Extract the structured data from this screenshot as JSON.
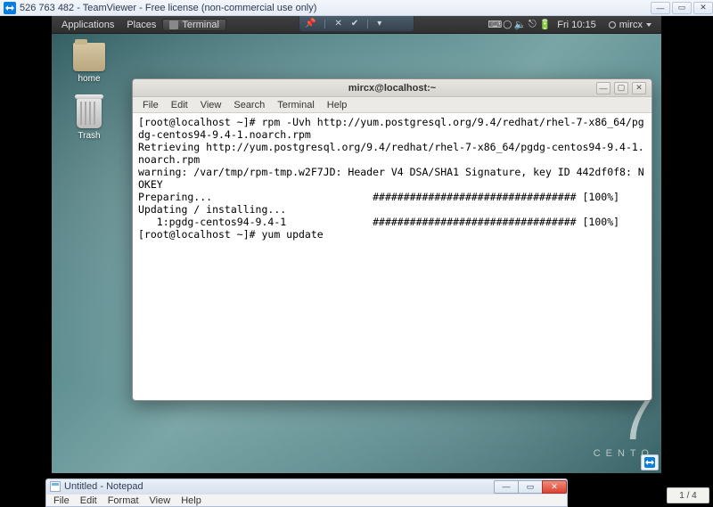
{
  "teamviewer_title": "526 763 482 - TeamViewer - Free license (non-commercial use only)",
  "gnome": {
    "applications": "Applications",
    "places": "Places",
    "task_terminal": "Terminal",
    "clock": "Fri 10:15",
    "user": "mircx"
  },
  "desktop": {
    "home": "home",
    "trash": "Trash",
    "centos_seven": "7",
    "centos_text": "CENTO"
  },
  "terminal": {
    "title": "mircx@localhost:~",
    "menu": {
      "file": "File",
      "edit": "Edit",
      "view": "View",
      "search": "Search",
      "terminal": "Terminal",
      "help": "Help"
    },
    "lines": {
      "l0": "[root@localhost ~]# rpm -Uvh http://yum.postgresql.org/9.4/redhat/rhel-7-x86_64/pgdg-centos94-9.4-1.noarch.rpm",
      "l1": "Retrieving http://yum.postgresql.org/9.4/redhat/rhel-7-x86_64/pgdg-centos94-9.4-1.noarch.rpm",
      "l2": "warning: /var/tmp/rpm-tmp.w2F7JD: Header V4 DSA/SHA1 Signature, key ID 442df0f8: NOKEY",
      "l3": "Preparing...                          ################################# [100%]",
      "l4": "Updating / installing...",
      "l5": "   1:pgdg-centos94-9.4-1              ################################# [100%]",
      "l6": "[root@localhost ~]# yum update"
    }
  },
  "notepad": {
    "title": "Untitled - Notepad",
    "menu": {
      "file": "File",
      "edit": "Edit",
      "format": "Format",
      "view": "View",
      "help": "Help"
    }
  },
  "pager": "1 / 4"
}
